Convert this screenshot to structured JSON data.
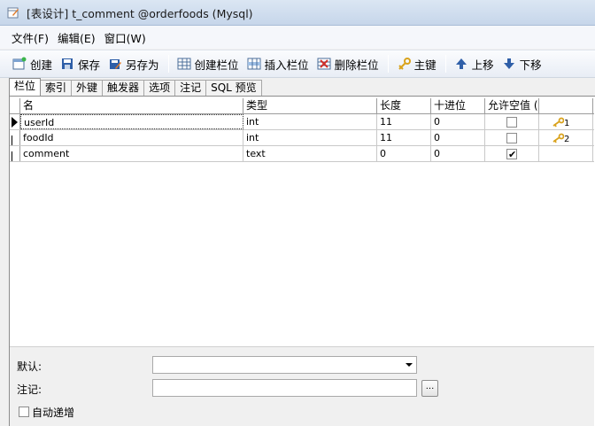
{
  "window": {
    "title": "[表设计] t_comment @orderfoods (Mysql)"
  },
  "menu": [
    "文件(F)",
    "编辑(E)",
    "窗口(W)"
  ],
  "toolbar": {
    "create": "创建",
    "save": "保存",
    "save_as": "另存为",
    "create_column": "创建栏位",
    "insert_column": "插入栏位",
    "delete_column": "删除栏位",
    "primary_key": "主键",
    "move_up": "上移",
    "move_down": "下移"
  },
  "tabs": [
    "栏位",
    "索引",
    "外键",
    "触发器",
    "选项",
    "注记",
    "SQL 预览"
  ],
  "grid": {
    "headers": {
      "name": "名",
      "type": "类型",
      "length": "长度",
      "decimals": "十进位",
      "nullable": "允许空值 (",
      "key": ""
    },
    "rows": [
      {
        "name": "userId",
        "type": "int",
        "length": "11",
        "decimals": "0",
        "nullable": false,
        "key": "1"
      },
      {
        "name": "foodId",
        "type": "int",
        "length": "11",
        "decimals": "0",
        "nullable": false,
        "key": "2"
      },
      {
        "name": "comment",
        "type": "text",
        "length": "0",
        "decimals": "0",
        "nullable": true,
        "key": ""
      }
    ]
  },
  "properties": {
    "default_label": "默认:",
    "comment_label": "注记:",
    "auto_increment_label": "自动递增",
    "browse_button": "..."
  },
  "icons": {
    "create": "new-table-icon",
    "save": "floppy-disk-icon",
    "save_as": "save-as-icon",
    "create_column": "create-column-icon",
    "insert_column": "insert-column-icon",
    "delete_column": "delete-column-icon",
    "primary_key": "key-icon",
    "move_up": "arrow-up-icon",
    "move_down": "arrow-down-icon"
  },
  "colors": {
    "key": "#d9a21b",
    "arrow": "#2f5fa8"
  }
}
